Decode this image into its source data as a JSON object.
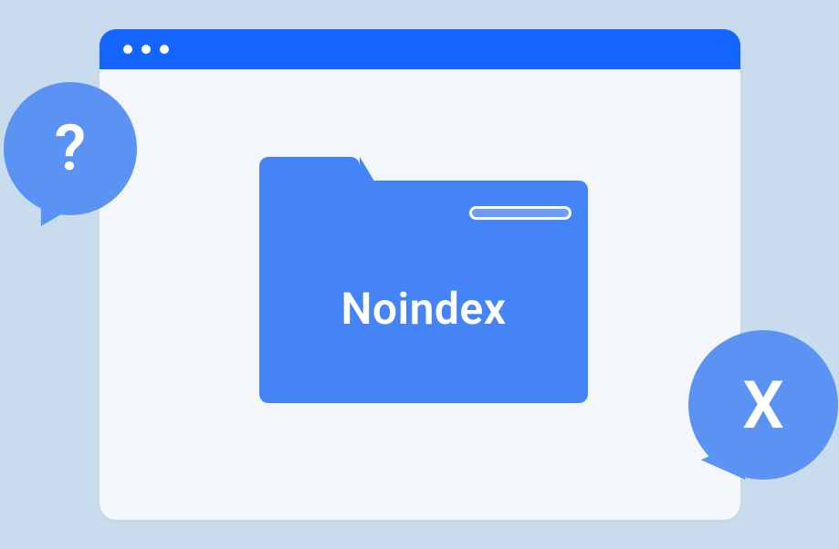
{
  "folder": {
    "label": "Noindex"
  },
  "bubbles": {
    "question": "?",
    "close": "X"
  }
}
